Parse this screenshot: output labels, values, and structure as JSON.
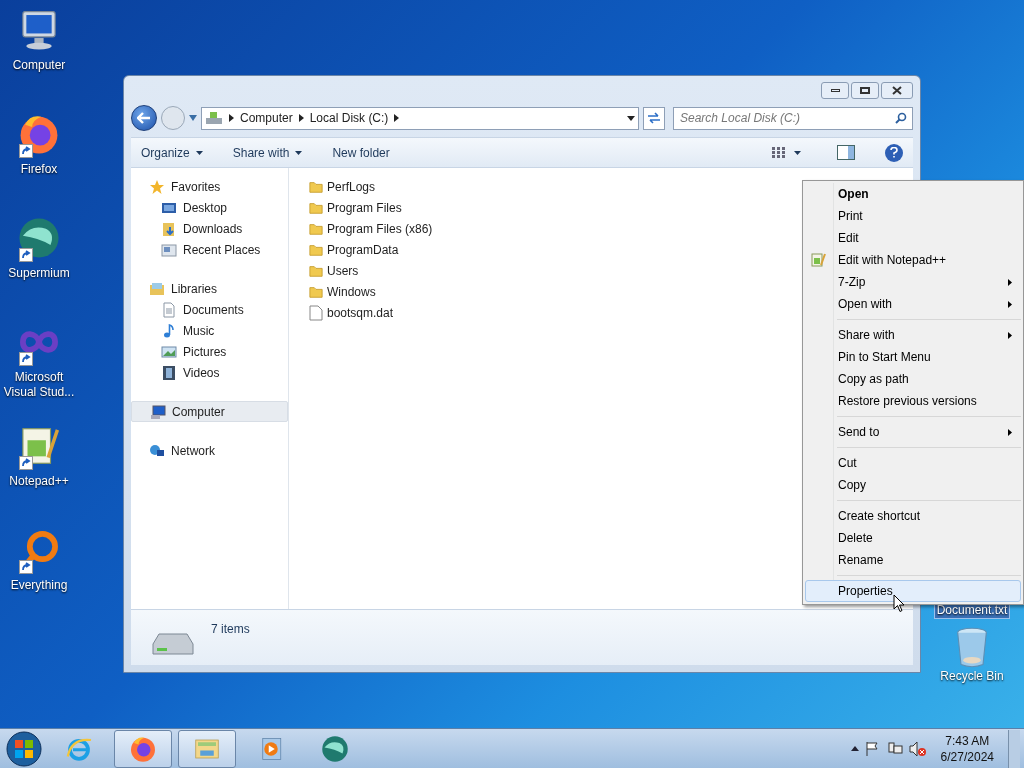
{
  "desktop_icons": [
    {
      "label": "Computer",
      "kind": "computer",
      "shortcut": false
    },
    {
      "label": "Firefox",
      "kind": "firefox",
      "shortcut": true
    },
    {
      "label": "Supermium",
      "kind": "supermium",
      "shortcut": true
    },
    {
      "label": "Microsoft Visual Stud...",
      "kind": "vs",
      "shortcut": true
    },
    {
      "label": "Notepad++",
      "kind": "notepad",
      "shortcut": true
    },
    {
      "label": "Everything",
      "kind": "everything",
      "shortcut": true
    }
  ],
  "desktop_right": [
    {
      "label": "Document.txt",
      "kind": "text",
      "selected": true
    },
    {
      "label": "Recycle Bin",
      "kind": "bin",
      "selected": false
    }
  ],
  "window": {
    "address": [
      "Computer",
      "Local Disk (C:)"
    ],
    "search": {
      "placeholder": "Search Local Disk (C:)"
    },
    "toolbar": [
      {
        "label": "Organize",
        "dropdown": true
      },
      {
        "label": "Share with",
        "dropdown": true
      },
      {
        "label": "New folder",
        "dropdown": false
      }
    ],
    "nav": [
      {
        "label": "Favorites",
        "kind": "star",
        "selected": false,
        "children": [
          {
            "label": "Desktop",
            "kind": "desktop",
            "selected": false
          },
          {
            "label": "Downloads",
            "kind": "downloads",
            "selected": false
          },
          {
            "label": "Recent Places",
            "kind": "recent",
            "selected": false
          }
        ]
      },
      {
        "label": "Libraries",
        "kind": "library",
        "selected": false,
        "children": [
          {
            "label": "Documents",
            "kind": "doc",
            "selected": false
          },
          {
            "label": "Music",
            "kind": "music",
            "selected": false
          },
          {
            "label": "Pictures",
            "kind": "pictures",
            "selected": false
          },
          {
            "label": "Videos",
            "kind": "videos",
            "selected": false
          }
        ]
      },
      {
        "label": "Computer",
        "kind": "computer",
        "selected": true
      },
      {
        "label": "Network",
        "kind": "network",
        "selected": false
      }
    ],
    "files": [
      {
        "name": "PerfLogs",
        "kind": "folder"
      },
      {
        "name": "Program Files",
        "kind": "folder"
      },
      {
        "name": "Program Files (x86)",
        "kind": "folder"
      },
      {
        "name": "ProgramData",
        "kind": "folder"
      },
      {
        "name": "Users",
        "kind": "folder"
      },
      {
        "name": "Windows",
        "kind": "folder"
      },
      {
        "name": "bootsqm.dat",
        "kind": "file"
      }
    ],
    "status": "7 items"
  },
  "context_menu": [
    [
      {
        "label": "Open",
        "bold": true,
        "submenu": false,
        "icon": false,
        "selected": false
      },
      {
        "label": "Print",
        "bold": false,
        "submenu": false,
        "icon": false,
        "selected": false
      },
      {
        "label": "Edit",
        "bold": false,
        "submenu": false,
        "icon": false,
        "selected": false
      },
      {
        "label": "Edit with Notepad++",
        "bold": false,
        "submenu": false,
        "icon": true,
        "selected": false
      },
      {
        "label": "7-Zip",
        "bold": false,
        "submenu": true,
        "icon": false,
        "selected": false
      },
      {
        "label": "Open with",
        "bold": false,
        "submenu": true,
        "icon": false,
        "selected": false
      }
    ],
    [
      {
        "label": "Share with",
        "bold": false,
        "submenu": true,
        "icon": false,
        "selected": false
      },
      {
        "label": "Pin to Start Menu",
        "bold": false,
        "submenu": false,
        "icon": false,
        "selected": false
      },
      {
        "label": "Copy as path",
        "bold": false,
        "submenu": false,
        "icon": false,
        "selected": false
      },
      {
        "label": "Restore previous versions",
        "bold": false,
        "submenu": false,
        "icon": false,
        "selected": false
      }
    ],
    [
      {
        "label": "Send to",
        "bold": false,
        "submenu": true,
        "icon": false,
        "selected": false
      }
    ],
    [
      {
        "label": "Cut",
        "bold": false,
        "submenu": false,
        "icon": false,
        "selected": false
      },
      {
        "label": "Copy",
        "bold": false,
        "submenu": false,
        "icon": false,
        "selected": false
      }
    ],
    [
      {
        "label": "Create shortcut",
        "bold": false,
        "submenu": false,
        "icon": false,
        "selected": false
      },
      {
        "label": "Delete",
        "bold": false,
        "submenu": false,
        "icon": false,
        "selected": false
      },
      {
        "label": "Rename",
        "bold": false,
        "submenu": false,
        "icon": false,
        "selected": false
      }
    ],
    [
      {
        "label": "Properties",
        "bold": false,
        "submenu": false,
        "icon": false,
        "selected": true
      }
    ]
  ],
  "taskbar": {
    "apps": [
      {
        "kind": "ie",
        "running": false
      },
      {
        "kind": "firefox",
        "running": true
      },
      {
        "kind": "explorer",
        "running": true
      },
      {
        "kind": "media",
        "running": false
      },
      {
        "kind": "supermium",
        "running": false
      }
    ],
    "time": "7:43 AM",
    "date": "6/27/2024"
  }
}
